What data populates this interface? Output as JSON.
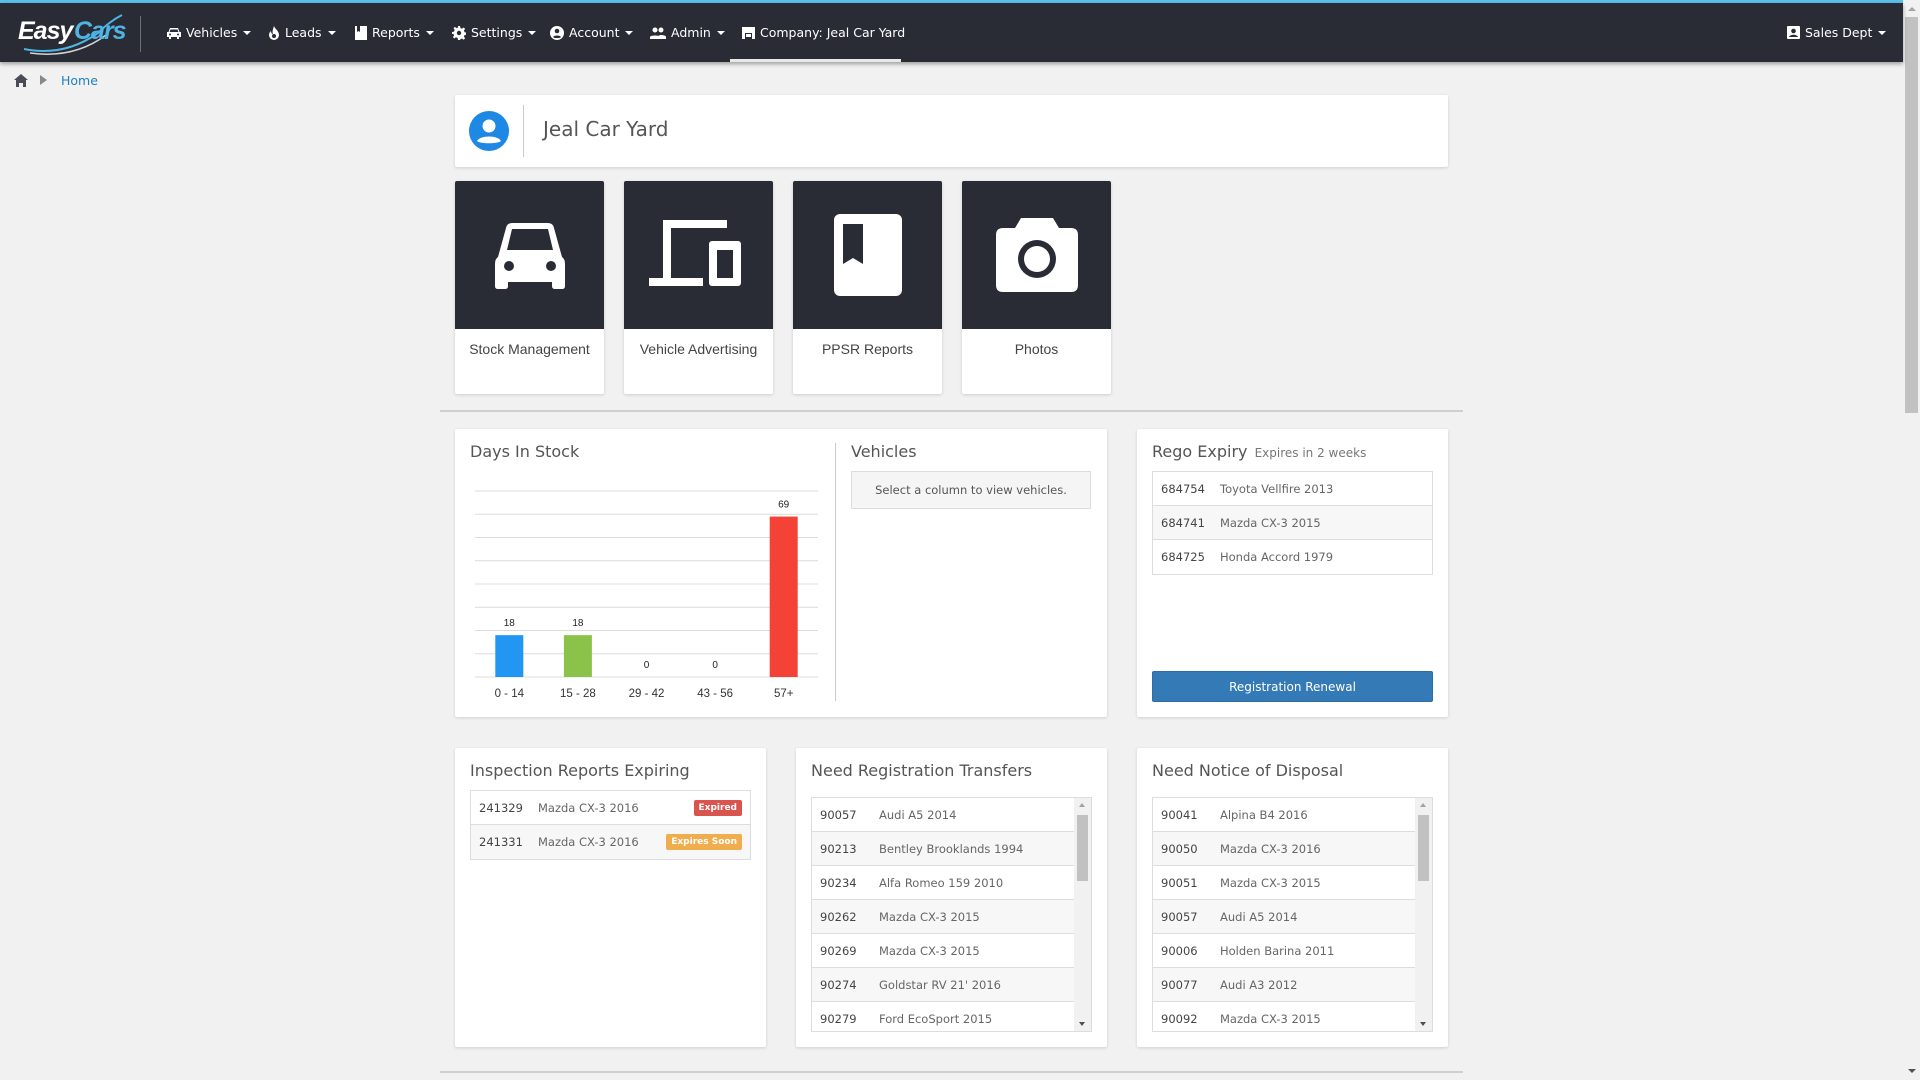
{
  "brand": {
    "part1": "Easy",
    "part2": "Cars"
  },
  "nav": {
    "items": [
      {
        "label": "Vehicles",
        "icon": "car-icon"
      },
      {
        "label": "Leads",
        "icon": "fire-icon"
      },
      {
        "label": "Reports",
        "icon": "bookmark-icon"
      },
      {
        "label": "Settings",
        "icon": "gear-icon"
      },
      {
        "label": "Account",
        "icon": "account-circle-icon"
      },
      {
        "label": "Admin",
        "icon": "users-icon"
      },
      {
        "label": "Company: Jeal Car Yard",
        "icon": "store-icon",
        "active": true
      }
    ],
    "right": {
      "label": "Sales Dept",
      "icon": "contact-card-icon"
    }
  },
  "breadcrumb": {
    "items": [
      "Home"
    ]
  },
  "company": {
    "name": "Jeal Car Yard",
    "icon": "user-circle-icon"
  },
  "tiles": [
    {
      "label": "Stock Management",
      "icon": "car-icon"
    },
    {
      "label": "Vehicle Advertising",
      "icon": "devices-icon"
    },
    {
      "label": "PPSR Reports",
      "icon": "book-icon"
    },
    {
      "label": "Photos",
      "icon": "camera-icon"
    }
  ],
  "days_in_stock": {
    "title": "Days In Stock",
    "vehicles_title": "Vehicles",
    "vehicles_placeholder": "Select a column to view vehicles."
  },
  "chart_data": {
    "type": "bar",
    "title": "Days In Stock",
    "xlabel": "",
    "ylabel": "",
    "categories": [
      "0 - 14",
      "15 - 28",
      "29 - 42",
      "43 - 56",
      "57+"
    ],
    "values": [
      18,
      18,
      0,
      0,
      69
    ],
    "colors": [
      "#2196f3",
      "#8bc34a",
      "#ff9800",
      "#9c27b0",
      "#f44336"
    ],
    "ylim": [
      0,
      80
    ],
    "grid": true,
    "grid_step": 10,
    "data_labels": true,
    "legend": "none"
  },
  "rego": {
    "title": "Rego Expiry",
    "subtitle": "Expires in 2 weeks",
    "rows": [
      {
        "id": "684754",
        "name": "Toyota Vellfire 2013"
      },
      {
        "id": "684741",
        "name": "Mazda CX-3 2015"
      },
      {
        "id": "684725",
        "name": "Honda Accord 1979"
      }
    ],
    "button": "Registration Renewal"
  },
  "inspection": {
    "title": "Inspection Reports Expiring",
    "rows": [
      {
        "id": "241329",
        "name": "Mazda CX-3 2016",
        "badge": "Expired",
        "badge_color": "#d9534f"
      },
      {
        "id": "241331",
        "name": "Mazda CX-3 2016",
        "badge": "Expires Soon",
        "badge_color": "#f0ad4e"
      }
    ]
  },
  "transfers": {
    "title": "Need Registration Transfers",
    "rows": [
      {
        "id": "90057",
        "name": "Audi A5 2014"
      },
      {
        "id": "90213",
        "name": "Bentley Brooklands 1994"
      },
      {
        "id": "90234",
        "name": "Alfa Romeo 159 2010"
      },
      {
        "id": "90262",
        "name": "Mazda CX-3 2015"
      },
      {
        "id": "90269",
        "name": "Mazda CX-3 2015"
      },
      {
        "id": "90274",
        "name": "Goldstar RV 21' 2016"
      },
      {
        "id": "90279",
        "name": "Ford EcoSport 2015"
      }
    ]
  },
  "disposal": {
    "title": "Need Notice of Disposal",
    "rows": [
      {
        "id": "90041",
        "name": "Alpina B4 2016"
      },
      {
        "id": "90050",
        "name": "Mazda CX-3 2016"
      },
      {
        "id": "90051",
        "name": "Mazda CX-3 2015"
      },
      {
        "id": "90057",
        "name": "Audi A5 2014"
      },
      {
        "id": "90006",
        "name": "Holden Barina 2011"
      },
      {
        "id": "90077",
        "name": "Audi A3 2012"
      },
      {
        "id": "90092",
        "name": "Mazda CX-3 2015"
      }
    ]
  },
  "colors": {
    "accent": "#5bc0e8",
    "nav_bg": "#292c35",
    "primary_button": "#337ab7",
    "link": "#1f7fc4"
  }
}
